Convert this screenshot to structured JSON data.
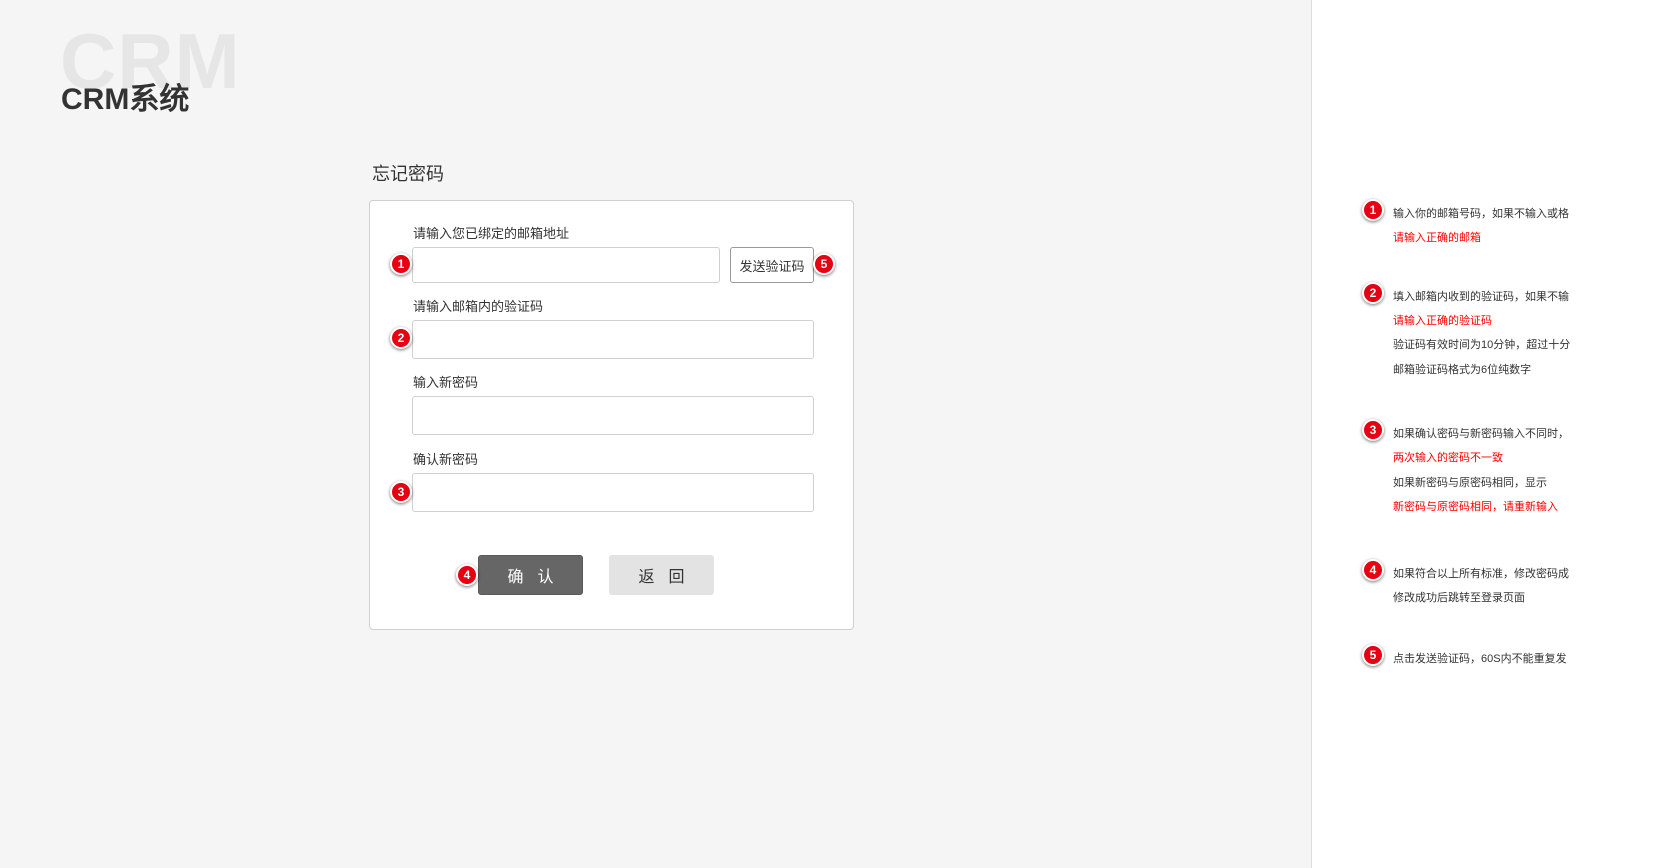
{
  "app": {
    "logo_watermark": "CRM",
    "title": "CRM系统"
  },
  "form": {
    "heading": "忘记密码",
    "email_label": "请输入您已绑定的邮箱地址",
    "email_value": "",
    "send_code_label": "发送验证码",
    "code_label": "请输入邮箱内的验证码",
    "code_value": "",
    "new_password_label": "输入新密码",
    "new_password_value": "",
    "confirm_password_label": "确认新密码",
    "confirm_password_value": "",
    "confirm_button": "确认",
    "back_button": "返回"
  },
  "markers": {
    "m1": "1",
    "m2": "2",
    "m3": "3",
    "m4": "4",
    "m5": "5"
  },
  "notes": {
    "n1": {
      "number": "1",
      "line1": "输入你的邮箱号码，如果不输入或格",
      "error": "请输入正确的邮箱"
    },
    "n2": {
      "number": "2",
      "line1": "填入邮箱内收到的验证码，如果不输",
      "error": "请输入正确的验证码",
      "line3": "验证码有效时间为10分钟，超过十分",
      "line4": "邮箱验证码格式为6位纯数字"
    },
    "n3": {
      "number": "3",
      "line1": "如果确认密码与新密码输入不同时，",
      "error1": "两次输入的密码不一致",
      "line3": "如果新密码与原密码相同，显示",
      "error2": "新密码与原密码相同，请重新输入"
    },
    "n4": {
      "number": "4",
      "line1": "如果符合以上所有标准，修改密码成",
      "line2": "修改成功后跳转至登录页面"
    },
    "n5": {
      "number": "5",
      "line1": "点击发送验证码，60S内不能重复发"
    }
  },
  "colors": {
    "page_background": "#f5f5f5",
    "marker_red": "#e60012",
    "error_text_red": "#ff0000",
    "confirm_button_bg": "#666666",
    "back_button_bg": "#e3e3e3"
  }
}
